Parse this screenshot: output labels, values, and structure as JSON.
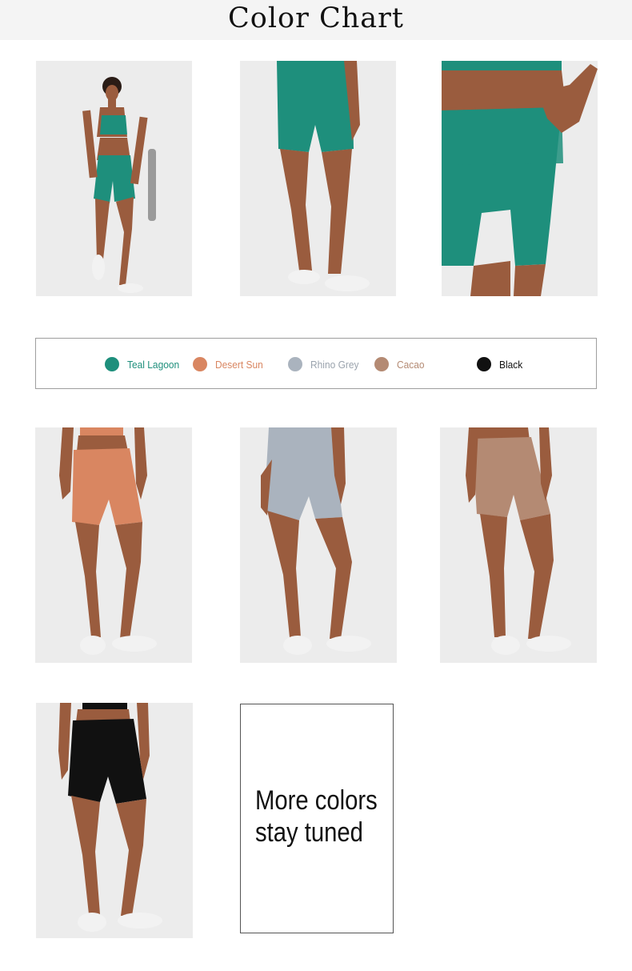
{
  "header": {
    "title": "Color Chart"
  },
  "colors": {
    "teal": "#1e8f7c",
    "desert_sun": "#d98661",
    "rhino_grey": "#aab3be",
    "cacao": "#b48a73",
    "black": "#111111",
    "skin": "#9a5c3e",
    "shoe": "#f2f2f2"
  },
  "legend": {
    "items": [
      {
        "label": "Teal Lagoon",
        "color": "#1e8f7c"
      },
      {
        "label": "Desert Sun",
        "color": "#d98661"
      },
      {
        "label": "Rhino Grey",
        "color": "#aab3be"
      },
      {
        "label": "Cacao",
        "color": "#b48a73"
      },
      {
        "label": "Black",
        "color": "#111111"
      }
    ]
  },
  "photos": [
    {
      "view": "full-body",
      "shorts_color": "#1e8f7c"
    },
    {
      "view": "back",
      "shorts_color": "#1e8f7c"
    },
    {
      "view": "waistband-closeup",
      "shorts_color": "#1e8f7c"
    },
    {
      "view": "front",
      "shorts_color": "#d98661"
    },
    {
      "view": "front",
      "shorts_color": "#aab3be"
    },
    {
      "view": "front",
      "shorts_color": "#b48a73"
    },
    {
      "view": "front",
      "shorts_color": "#111111"
    }
  ],
  "more": {
    "line1": "More colors",
    "line2": "stay tuned"
  }
}
